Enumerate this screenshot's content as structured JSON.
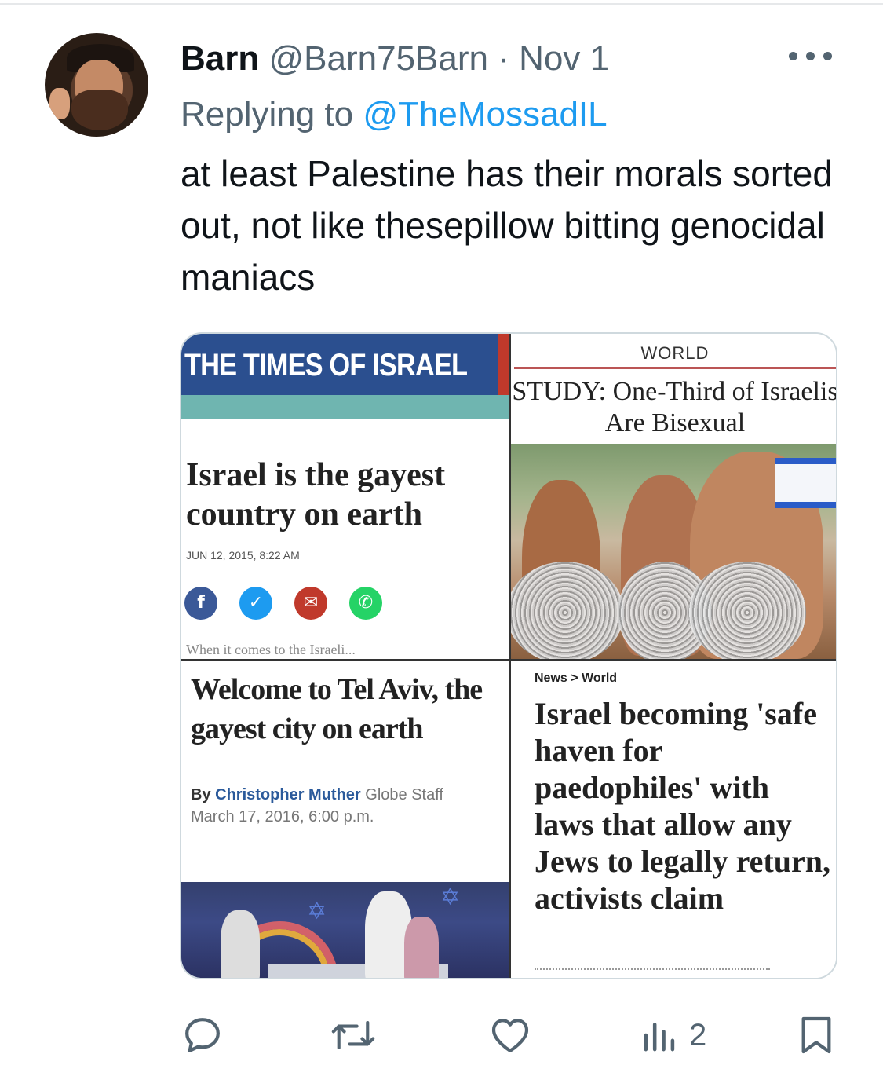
{
  "tweet": {
    "author_name": "Barn",
    "handle": "@Barn75Barn",
    "separator": "·",
    "date": "Nov 1",
    "replying_prefix": "Replying to",
    "replying_mention": "@TheMossadIL",
    "text": "at least Palestine has their morals sorted out, not like thesepillow bitting genocidal maniacs"
  },
  "media": {
    "panel1": {
      "masthead": "THE TIMES OF ISRAEL",
      "headline": "Israel is the gayest country on earth",
      "date": "JUN 12, 2015, 8:22 AM",
      "share_icons": [
        "facebook-icon",
        "twitter-icon",
        "email-icon",
        "whatsapp-icon"
      ],
      "cut_text": "When it comes to the Israeli..."
    },
    "panel2": {
      "section": "WORLD",
      "headline": "STUDY: One-Third of Israelis Are Bisexual"
    },
    "panel3": {
      "headline": "Welcome to Tel Aviv, the gayest city on earth",
      "by": "By",
      "author": "Christopher Muther",
      "staff": "Globe Staff",
      "date": "March 17, 2016, 6:00 p.m."
    },
    "panel4": {
      "breadcrumb": "News > World",
      "headline": "Israel becoming 'safe haven for paedophiles' with laws that allow any Jews to legally return, activists claim"
    }
  },
  "actions": {
    "reply_icon": "reply-icon",
    "retweet_icon": "retweet-icon",
    "like_icon": "heart-icon",
    "views_icon": "views-icon",
    "views_count": "2",
    "bookmark_icon": "bookmark-icon"
  },
  "colors": {
    "accent": "#1d9bf0",
    "secondary_text": "#536471",
    "primary_text": "#0f1419"
  }
}
